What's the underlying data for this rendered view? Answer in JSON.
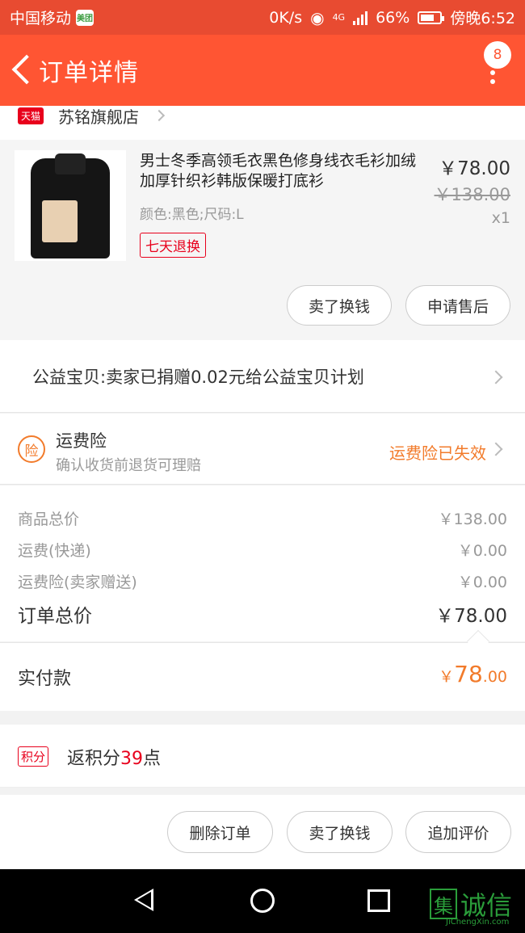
{
  "status_bar": {
    "carrier": "中国移动",
    "app_badge": "美团",
    "speed": "0K/s",
    "network": "4G",
    "battery": "66%",
    "time": "傍晚6:52"
  },
  "header": {
    "title": "订单详情",
    "badge_count": "8"
  },
  "shop": {
    "tmall_label": "天猫",
    "name": "苏铭旗舰店"
  },
  "product": {
    "title": "男士冬季高领毛衣黑色修身线衣毛衫加绒加厚针织衫韩版保暖打底衫",
    "spec": "颜色:黑色;尺码:L",
    "tag": "七天退换",
    "price": "￥78.00",
    "original_price": "￥138.00",
    "quantity": "x1",
    "sell_button": "卖了换钱",
    "aftersale_button": "申请售后"
  },
  "charity": {
    "text": "公益宝贝:卖家已捐赠0.02元给公益宝贝计划"
  },
  "insurance": {
    "icon_label": "险",
    "title": "运费险",
    "subtitle": "确认收货前退货可理赔",
    "status": "运费险已失效"
  },
  "summary": {
    "rows": [
      {
        "label": "商品总价",
        "value": "￥138.00"
      },
      {
        "label": "运费(快递)",
        "value": "￥0.00"
      },
      {
        "label": "运费险(卖家赠送)",
        "value": "￥0.00"
      }
    ],
    "total_label": "订单总价",
    "total_value": "￥78.00",
    "paid_label": "实付款",
    "paid_currency": "￥",
    "paid_integer": "78",
    "paid_decimal": ".00"
  },
  "points": {
    "badge": "积分",
    "prefix": "返积分",
    "amount": "39",
    "suffix": "点"
  },
  "actions": {
    "delete": "删除订单",
    "sell": "卖了换钱",
    "review": "追加评价"
  },
  "watermark": {
    "logo_char": "集",
    "text": "诚信",
    "sub": "JiChengXin.com"
  }
}
